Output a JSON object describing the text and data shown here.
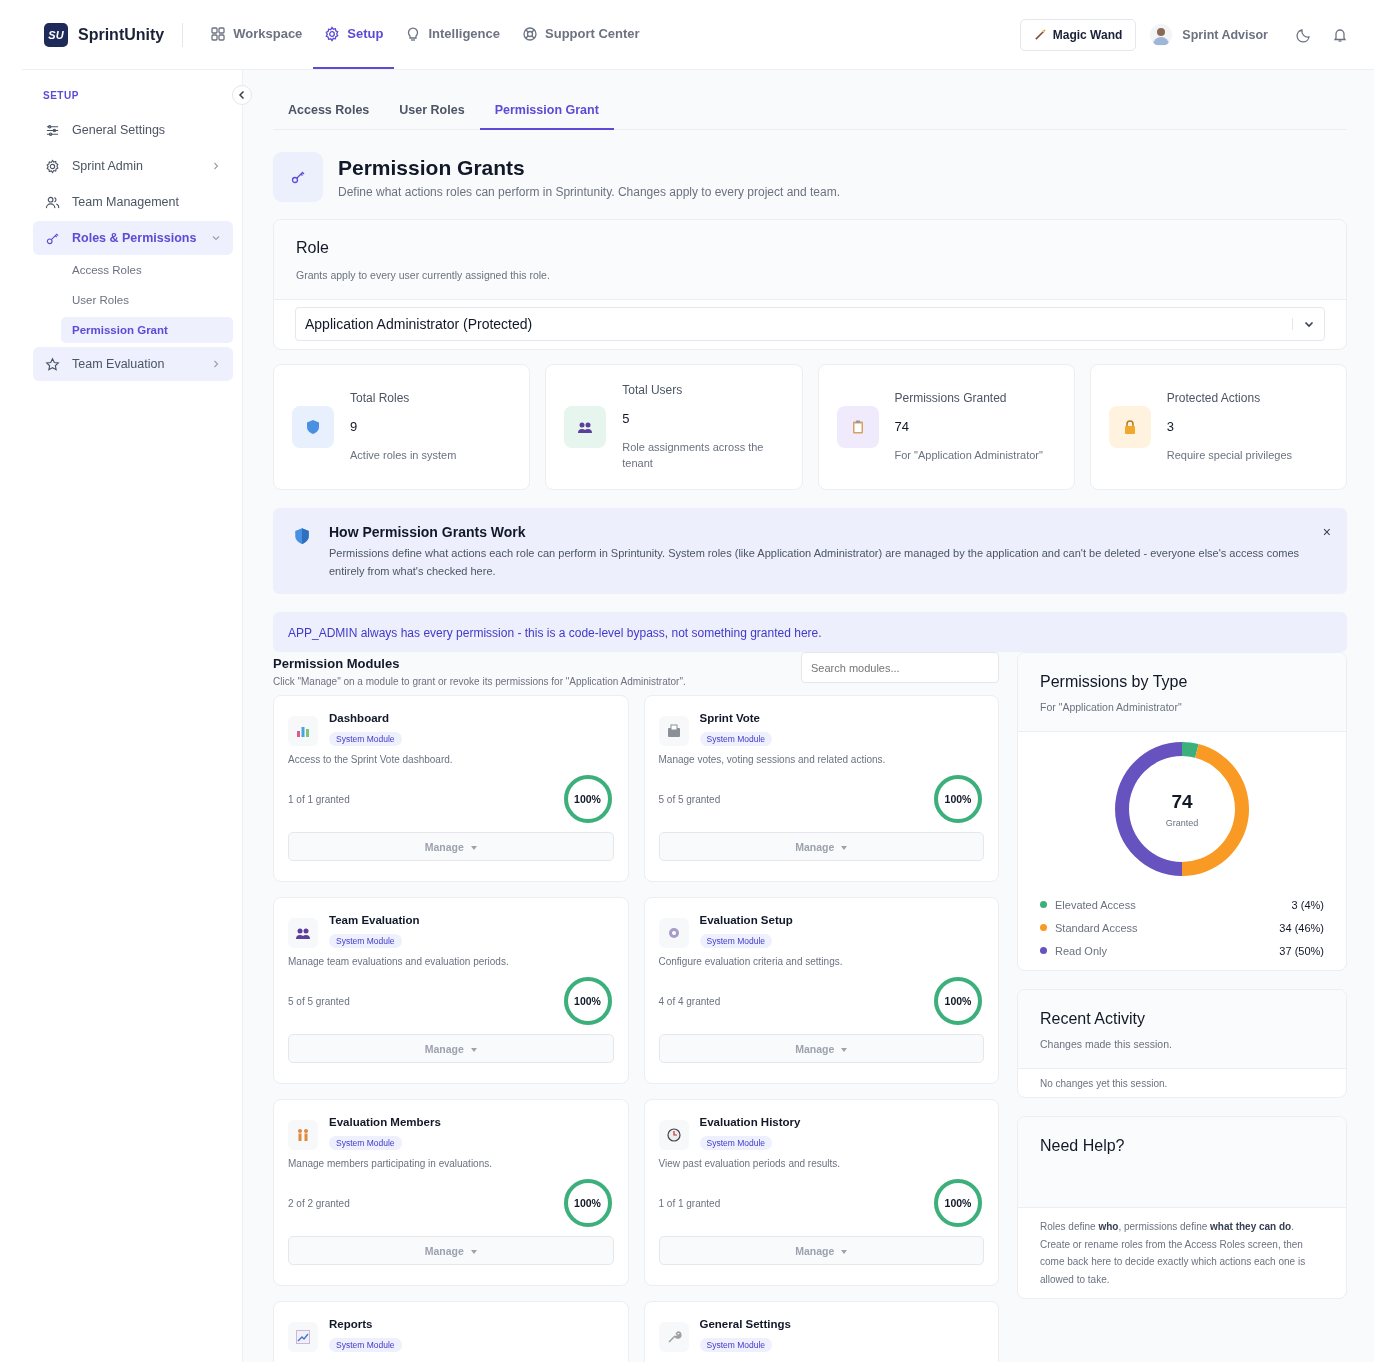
{
  "brand": {
    "name": "SprintUnity",
    "logo": "SU"
  },
  "nav": [
    {
      "label": "Workspace",
      "selected": false
    },
    {
      "label": "Setup",
      "selected": true
    },
    {
      "label": "Intelligence",
      "selected": false
    },
    {
      "label": "Support Center",
      "selected": false
    }
  ],
  "header_actions": {
    "magic_button": "Magic Wand",
    "user_name": "Sprint Advisor"
  },
  "sidebar": {
    "section": "SETUP",
    "items": [
      {
        "label": "General Settings",
        "selected": false
      },
      {
        "label": "Sprint Admin",
        "selected": false,
        "expanded": false
      },
      {
        "label": "Team Management",
        "selected": false
      },
      {
        "label": "Roles & Permissions",
        "selected": true,
        "expanded": true,
        "children": [
          {
            "label": "Access Roles",
            "selected": false
          },
          {
            "label": "User Roles",
            "selected": false
          },
          {
            "label": "Permission Grant",
            "selected": true
          }
        ]
      },
      {
        "label": "Team Evaluation",
        "selected": true,
        "expanded": false
      }
    ]
  },
  "tabs": [
    {
      "label": "Access Roles",
      "selected": false
    },
    {
      "label": "User Roles",
      "selected": false
    },
    {
      "label": "Permission Grant",
      "selected": true
    }
  ],
  "page": {
    "title": "Permission Grants",
    "subtitle": "Define what actions roles can perform in Sprintunity. Changes apply to every project and team."
  },
  "role": {
    "title": "Role",
    "hint": "Grants apply to every user currently assigned this role.",
    "value": "Application Administrator (Protected)"
  },
  "stats": [
    {
      "label": "Total Roles",
      "value": "9",
      "caption": "Active roles in system"
    },
    {
      "label": "Total Users",
      "value": "5",
      "caption": "Role assignments across the tenant"
    },
    {
      "label": "Permissions Granted",
      "value": "74",
      "caption": "For \"Application Administrator\""
    },
    {
      "label": "Protected Actions",
      "value": "3",
      "caption": "Require special privileges"
    }
  ],
  "info": {
    "title": "How Permission Grants Work",
    "text": "Permissions define what actions each role can perform in Sprintunity. System roles (like Application Administrator) are managed by the application and can't be deleted - everyone else's access comes entirely from what's checked here.",
    "close": "×"
  },
  "notice": "APP_ADMIN always has every permission - this is a code-level bypass, not something granted here.",
  "modules_section": {
    "title": "Permission Modules",
    "hint": "Click \"Manage\" on a module to grant or revoke its permissions for \"Application Administrator\".",
    "search_placeholder": "Search modules..."
  },
  "modules": [
    {
      "name": "Dashboard",
      "tag": "System Module",
      "description": "Access to the Sprint Vote dashboard.",
      "granted": "1 of 1 granted",
      "percent": "100%",
      "level": 1,
      "button": "Manage"
    },
    {
      "name": "Sprint Vote",
      "tag": "System Module",
      "description": "Manage votes, voting sessions and related actions.",
      "granted": "5 of 5 granted",
      "percent": "100%",
      "level": 1,
      "button": "Manage"
    },
    {
      "name": "Team Evaluation",
      "tag": "System Module",
      "description": "Manage team evaluations and evaluation periods.",
      "granted": "5 of 5 granted",
      "percent": "100%",
      "level": 1,
      "button": "Manage"
    },
    {
      "name": "Evaluation Setup",
      "tag": "System Module",
      "description": "Configure evaluation criteria and settings.",
      "granted": "4 of 4 granted",
      "percent": "100%",
      "level": 1,
      "button": "Manage"
    },
    {
      "name": "Evaluation Members",
      "tag": "System Module",
      "description": "Manage members participating in evaluations.",
      "granted": "2 of 2 granted",
      "percent": "100%",
      "level": 1,
      "button": "Manage"
    },
    {
      "name": "Evaluation History",
      "tag": "System Module",
      "description": "View past evaluation periods and results.",
      "granted": "1 of 1 granted",
      "percent": "100%",
      "level": 1,
      "button": "Manage"
    },
    {
      "name": "Reports",
      "tag": "System Module"
    },
    {
      "name": "General Settings",
      "tag": "System Module"
    }
  ],
  "permissions_by_type": {
    "title": "Permissions by Type",
    "subtitle": "For \"Application Administrator\"",
    "total": "74",
    "total_label": "Granted",
    "chart_data": {
      "type": "donut",
      "categories": [
        "Elevated Access",
        "Standard Access",
        "Read Only"
      ],
      "values": [
        4,
        46,
        50
      ],
      "colors": [
        "#3bb07b",
        "#f99a25",
        "#6753bf"
      ],
      "value_labels": [
        "3 (4%)",
        "34 (46%)",
        "37 (50%)"
      ]
    }
  },
  "recent_activity": {
    "title": "Recent Activity",
    "subtitle": "Changes made this session.",
    "empty": "No changes yet this session."
  },
  "help": {
    "title": "Need Help?",
    "text": "Roles define **who**, permissions define **what they can do**. Create or rename roles from the Access Roles screen, then come back here to decide exactly which actions each one is allowed to take."
  }
}
